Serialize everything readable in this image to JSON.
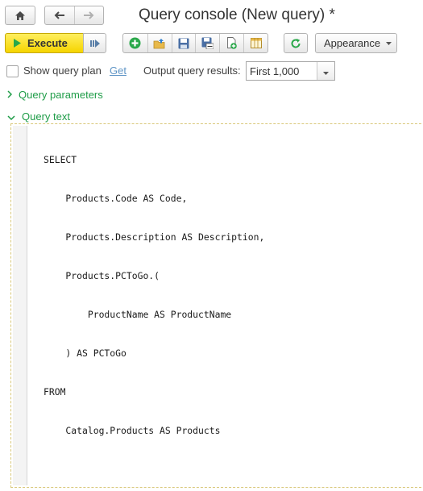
{
  "window": {
    "title": "Query console (New query) *"
  },
  "toolbar": {
    "execute_label": "Execute",
    "appearance_label": "Appearance"
  },
  "icons": {
    "home": "home-icon",
    "back": "arrow-left-icon",
    "forward": "arrow-right-icon",
    "play": "play-icon",
    "more": "more-icon",
    "add": "add-icon",
    "open": "open-folder-icon",
    "save": "save-icon",
    "save_as": "save-as-icon",
    "new_doc": "new-document-icon",
    "table": "table-icon",
    "refresh": "refresh-icon"
  },
  "options": {
    "show_plan_label": "Show query plan",
    "show_plan_checked": false,
    "get_link": "Get",
    "output_label": "Output query results:",
    "output_value": "First 1,000"
  },
  "sections": {
    "params_label": "Query parameters",
    "params_expanded": false,
    "query_text_label": "Query text",
    "query_text_expanded": true
  },
  "query": {
    "lines": [
      "SELECT",
      "    Products.Code AS Code,",
      "    Products.Description AS Description,",
      "    Products.PCToGo.(",
      "        ProductName AS ProductName",
      "    ) AS PCToGo",
      "FROM",
      "    Catalog.Products AS Products"
    ]
  },
  "colors": {
    "accent_green": "#1e9c47",
    "execute_yellow": "#f5d400",
    "link_blue": "#5f95c6"
  }
}
